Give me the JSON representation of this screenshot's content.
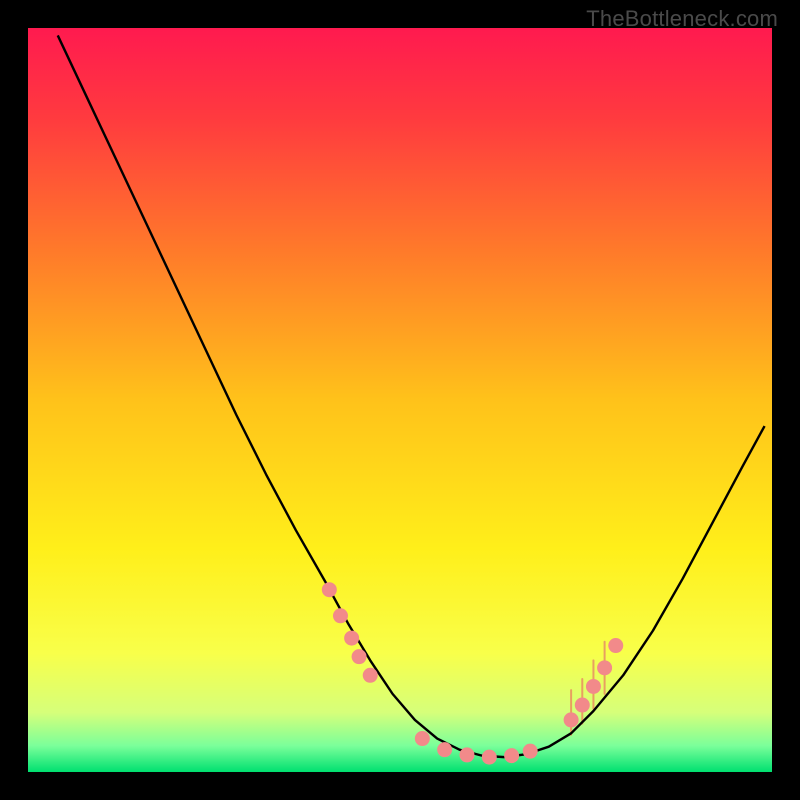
{
  "watermark_text": "TheBottleneck.com",
  "chart_data": {
    "type": "line",
    "title": "",
    "xlabel": "",
    "ylabel": "",
    "xlim": [
      0,
      100
    ],
    "ylim": [
      0,
      100
    ],
    "grid": false,
    "legend": false,
    "gradient_stops": [
      {
        "offset": 0.0,
        "color": "#ff1a4f"
      },
      {
        "offset": 0.12,
        "color": "#ff3a3f"
      },
      {
        "offset": 0.3,
        "color": "#ff7a2a"
      },
      {
        "offset": 0.5,
        "color": "#ffc21a"
      },
      {
        "offset": 0.7,
        "color": "#ffef1a"
      },
      {
        "offset": 0.84,
        "color": "#f8ff4a"
      },
      {
        "offset": 0.92,
        "color": "#d6ff7a"
      },
      {
        "offset": 0.965,
        "color": "#7aff9a"
      },
      {
        "offset": 1.0,
        "color": "#00e070"
      }
    ],
    "series": [
      {
        "name": "curve",
        "color": "#000000",
        "x": [
          4,
          8,
          12,
          16,
          20,
          24,
          28,
          32,
          36,
          40,
          43,
          46,
          49,
          52,
          55,
          58,
          61,
          64,
          67,
          70,
          73,
          76,
          80,
          84,
          88,
          92,
          96,
          99
        ],
        "y": [
          99,
          90.5,
          82,
          73.5,
          65,
          56.5,
          48,
          40,
          32.5,
          25.5,
          20,
          15,
          10.5,
          7,
          4.5,
          3,
          2.2,
          2,
          2.4,
          3.4,
          5.2,
          8.2,
          13,
          19,
          26,
          33.5,
          41,
          46.5
        ]
      }
    ],
    "markers": {
      "name": "dots",
      "color": "#f28a8a",
      "radius_px": 7.5,
      "points": [
        {
          "x": 40.5,
          "y": 24.5
        },
        {
          "x": 42.0,
          "y": 21.0
        },
        {
          "x": 43.5,
          "y": 18.0
        },
        {
          "x": 44.5,
          "y": 15.5
        },
        {
          "x": 46.0,
          "y": 13.0
        },
        {
          "x": 53.0,
          "y": 4.5
        },
        {
          "x": 56.0,
          "y": 3.0
        },
        {
          "x": 59.0,
          "y": 2.3
        },
        {
          "x": 62.0,
          "y": 2.0
        },
        {
          "x": 65.0,
          "y": 2.2
        },
        {
          "x": 67.5,
          "y": 2.8
        },
        {
          "x": 73.0,
          "y": 7.0
        },
        {
          "x": 74.5,
          "y": 9.0
        },
        {
          "x": 76.0,
          "y": 11.5
        },
        {
          "x": 77.5,
          "y": 14.0
        },
        {
          "x": 79.0,
          "y": 17.0
        }
      ]
    },
    "feeler_lines": {
      "color": "#e8a060",
      "stroke_px": 2,
      "lines": [
        {
          "x": 73.0,
          "y0": 5.0,
          "y1": 11.0
        },
        {
          "x": 74.5,
          "y0": 6.5,
          "y1": 12.5
        },
        {
          "x": 76.0,
          "y0": 8.5,
          "y1": 15.0
        },
        {
          "x": 77.5,
          "y0": 10.5,
          "y1": 17.5
        }
      ]
    }
  }
}
